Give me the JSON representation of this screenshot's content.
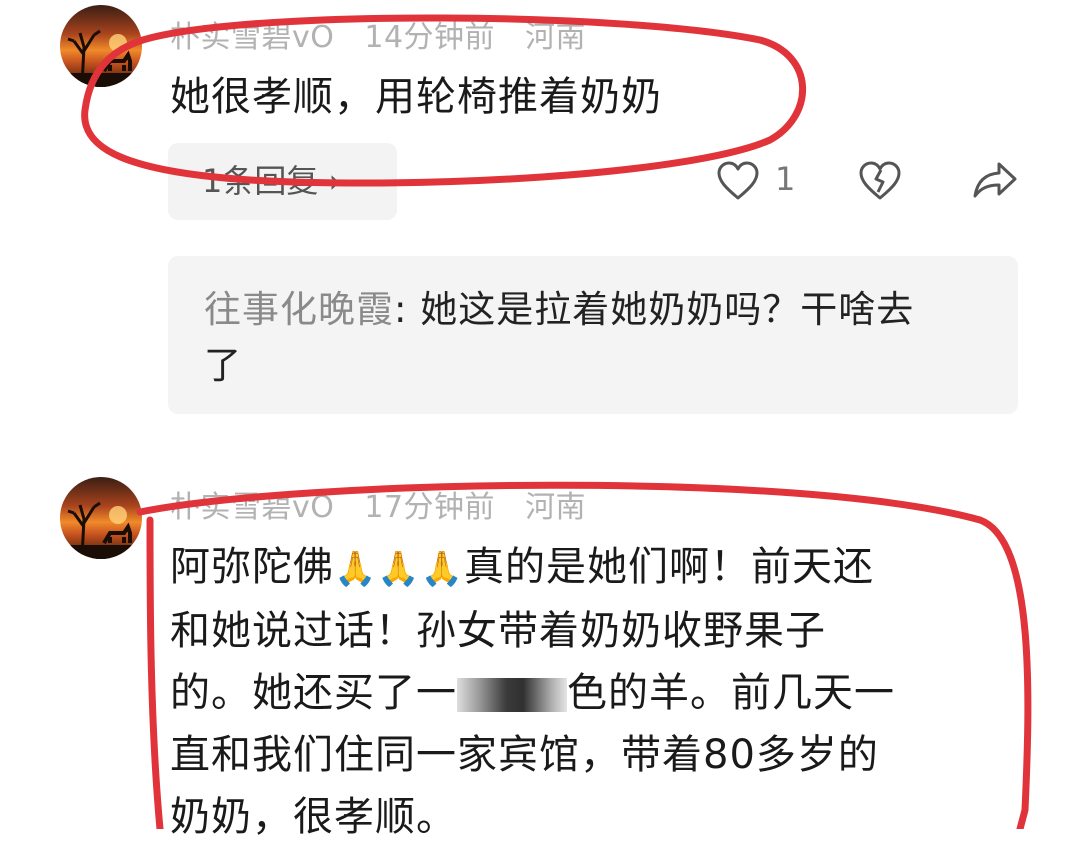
{
  "comments": [
    {
      "author": "朴实雪碧vO",
      "time": "14分钟前",
      "location": "河南",
      "text": "她很孝顺，用轮椅推着奶奶",
      "reply_label": "1条回复 ›",
      "like_count": "1",
      "reply_preview": {
        "author": "往事化晚霞",
        "separator": ": ",
        "text_line1": "她这是拉着她奶奶吗？干啥去",
        "text_line2": "了"
      }
    },
    {
      "author": "朴实雪碧vO",
      "time": "17分钟前",
      "location": "河南",
      "text_part1": "阿弥陀佛",
      "emoji": "🙏🙏🙏",
      "text_part2": "真的是她们啊！前天还",
      "line2": "和她说过话！孙女带着奶奶收野果子",
      "line3_pre": "的。她还买了一",
      "line3_post": "色的羊。前几天一",
      "line4": "直和我们住同一家宾馆，带着80多岁的",
      "line5": "奶奶，很孝顺。"
    }
  ],
  "icons": [
    "heart-icon",
    "dislike-heart-icon",
    "share-icon"
  ],
  "annotation_color": "#e0343a"
}
